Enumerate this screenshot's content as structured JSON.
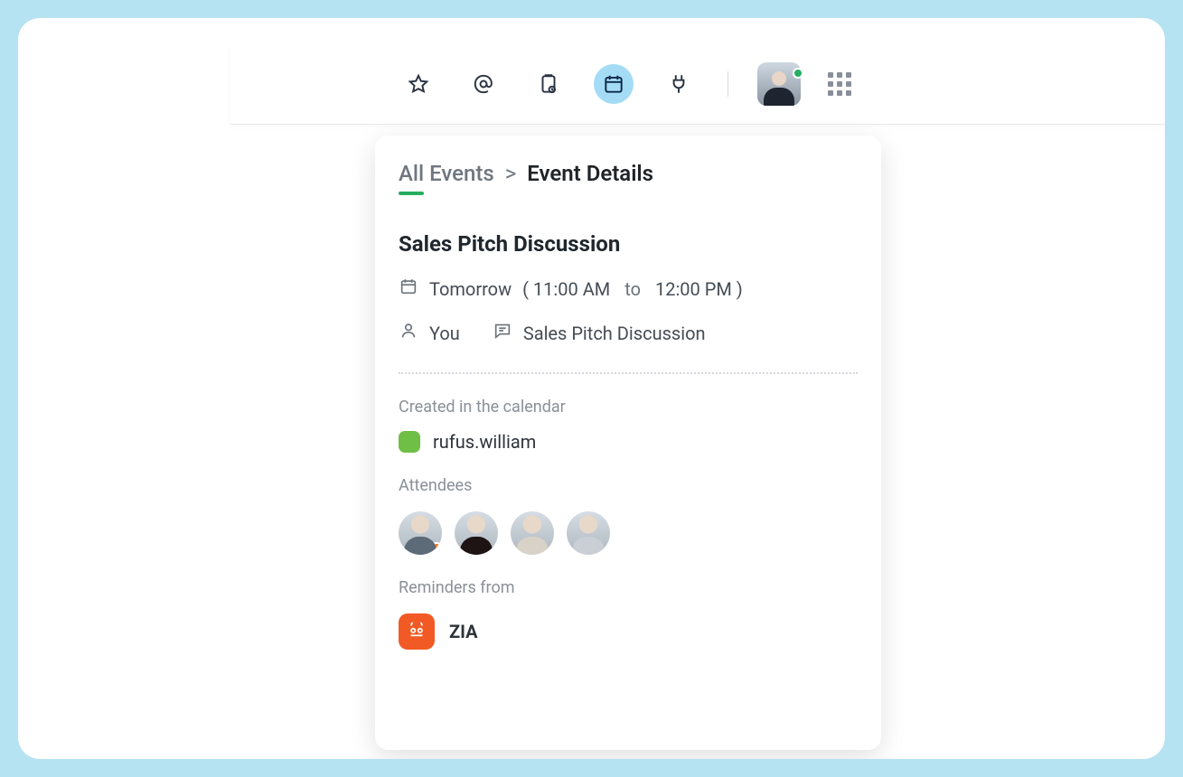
{
  "toolbar": {
    "icons": {
      "star": "star-icon",
      "mention": "mention-icon",
      "clipboard": "clipboard-clock-icon",
      "calendar": "calendar-icon",
      "plug": "plug-icon"
    },
    "active_icon": "calendar",
    "presence": "online"
  },
  "breadcrumb": {
    "root": "All Events",
    "separator": ">",
    "current": "Event Details"
  },
  "event": {
    "title": "Sales Pitch Discussion",
    "date_label": "Tomorrow",
    "time_open": "( 11:00 AM",
    "time_to_word": "to",
    "time_close": "12:00 PM )",
    "host_label": "You",
    "chat_label": "Sales Pitch Discussion"
  },
  "calendar_section": {
    "label": "Created in the calendar",
    "owner": "rufus.william",
    "color": "#6fbf46"
  },
  "attendees_section": {
    "label": "Attendees",
    "count": 4
  },
  "reminders_section": {
    "label": "Reminders from",
    "source": "ZIA"
  }
}
